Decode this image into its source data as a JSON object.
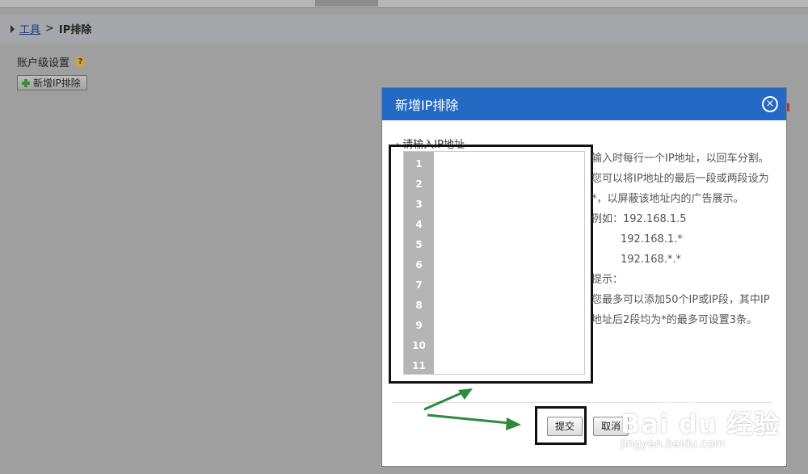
{
  "breadcrumb": {
    "link": "工具",
    "separator": ">",
    "current": "IP排除"
  },
  "account": {
    "label": "账户级设置",
    "help": "?"
  },
  "add_button": {
    "label": "新增IP排除"
  },
  "dialog": {
    "title": "新增IP排除",
    "close_icon": "×",
    "input_label": "· 请输入IP地址",
    "line_numbers": [
      "1",
      "2",
      "3",
      "4",
      "5",
      "6",
      "7",
      "8",
      "9",
      "10",
      "11"
    ],
    "desc_lines": [
      "输入时每行一个IP地址，以回车分割。",
      "您可以将IP地址的最后一段或两段设为",
      "*，以屏蔽该地址内的广告展示。",
      "例如：192.168.1.5",
      "192.168.1.*",
      "192.168.*.*",
      "提示：",
      "您最多可以添加50个IP或IP段，其中IP",
      "地址后2段均为*的最多可设置3条。"
    ],
    "submit": "提交",
    "cancel": "取消"
  },
  "watermark": {
    "brand": "Bai du 经验",
    "url": "jingyan.baidu.com"
  },
  "colors": {
    "header": "#2469c4",
    "arrow": "#2e8a3c"
  }
}
